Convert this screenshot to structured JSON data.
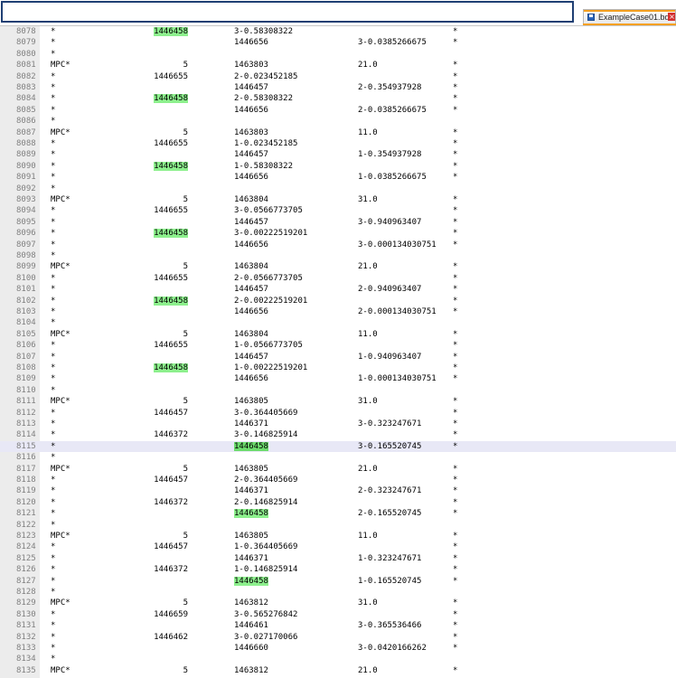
{
  "search": {
    "value": ""
  },
  "tab": {
    "label": "ExampleCase01.bdf",
    "icon": "save-icon",
    "close_icon": "close-icon"
  },
  "active_line": "8115",
  "highlight_token": "1446458",
  "colors": {
    "highlight": "#8df08d",
    "active_line": "#e8e8f6",
    "tab_accent": "#f4a020",
    "search_border": "#1f3f73"
  },
  "lines": [
    {
      "n": "8078",
      "c1": "*",
      "c2": "1446458",
      "c3": "3-0.58308322",
      "c4": "",
      "c5": "*"
    },
    {
      "n": "8079",
      "c1": "*",
      "c2": "",
      "c3": "1446656",
      "c4": "3-0.0385266675",
      "c5": "*"
    },
    {
      "n": "8080",
      "c1": "*",
      "c2": "",
      "c3": "",
      "c4": "",
      "c5": ""
    },
    {
      "n": "8081",
      "c1": "MPC*",
      "c2": "5",
      "c3": "1463803",
      "c4": "21.0",
      "c5": "*"
    },
    {
      "n": "8082",
      "c1": "*",
      "c2": "1446655",
      "c3": "2-0.023452185",
      "c4": "",
      "c5": "*"
    },
    {
      "n": "8083",
      "c1": "*",
      "c2": "",
      "c3": "1446457",
      "c4": "2-0.354937928",
      "c5": "*"
    },
    {
      "n": "8084",
      "c1": "*",
      "c2": "1446458",
      "c3": "2-0.58308322",
      "c4": "",
      "c5": "*"
    },
    {
      "n": "8085",
      "c1": "*",
      "c2": "",
      "c3": "1446656",
      "c4": "2-0.0385266675",
      "c5": "*"
    },
    {
      "n": "8086",
      "c1": "*",
      "c2": "",
      "c3": "",
      "c4": "",
      "c5": ""
    },
    {
      "n": "8087",
      "c1": "MPC*",
      "c2": "5",
      "c3": "1463803",
      "c4": "11.0",
      "c5": "*"
    },
    {
      "n": "8088",
      "c1": "*",
      "c2": "1446655",
      "c3": "1-0.023452185",
      "c4": "",
      "c5": "*"
    },
    {
      "n": "8089",
      "c1": "*",
      "c2": "",
      "c3": "1446457",
      "c4": "1-0.354937928",
      "c5": "*"
    },
    {
      "n": "8090",
      "c1": "*",
      "c2": "1446458",
      "c3": "1-0.58308322",
      "c4": "",
      "c5": "*"
    },
    {
      "n": "8091",
      "c1": "*",
      "c2": "",
      "c3": "1446656",
      "c4": "1-0.0385266675",
      "c5": "*"
    },
    {
      "n": "8092",
      "c1": "*",
      "c2": "",
      "c3": "",
      "c4": "",
      "c5": ""
    },
    {
      "n": "8093",
      "c1": "MPC*",
      "c2": "5",
      "c3": "1463804",
      "c4": "31.0",
      "c5": "*"
    },
    {
      "n": "8094",
      "c1": "*",
      "c2": "1446655",
      "c3": "3-0.0566773705",
      "c4": "",
      "c5": "*"
    },
    {
      "n": "8095",
      "c1": "*",
      "c2": "",
      "c3": "1446457",
      "c4": "3-0.940963407",
      "c5": "*"
    },
    {
      "n": "8096",
      "c1": "*",
      "c2": "1446458",
      "c3": "3-0.00222519201",
      "c4": "",
      "c5": "*"
    },
    {
      "n": "8097",
      "c1": "*",
      "c2": "",
      "c3": "1446656",
      "c4": "3-0.000134030751",
      "c5": "*"
    },
    {
      "n": "8098",
      "c1": "*",
      "c2": "",
      "c3": "",
      "c4": "",
      "c5": ""
    },
    {
      "n": "8099",
      "c1": "MPC*",
      "c2": "5",
      "c3": "1463804",
      "c4": "21.0",
      "c5": "*"
    },
    {
      "n": "8100",
      "c1": "*",
      "c2": "1446655",
      "c3": "2-0.0566773705",
      "c4": "",
      "c5": "*"
    },
    {
      "n": "8101",
      "c1": "*",
      "c2": "",
      "c3": "1446457",
      "c4": "2-0.940963407",
      "c5": "*"
    },
    {
      "n": "8102",
      "c1": "*",
      "c2": "1446458",
      "c3": "2-0.00222519201",
      "c4": "",
      "c5": "*"
    },
    {
      "n": "8103",
      "c1": "*",
      "c2": "",
      "c3": "1446656",
      "c4": "2-0.000134030751",
      "c5": "*"
    },
    {
      "n": "8104",
      "c1": "*",
      "c2": "",
      "c3": "",
      "c4": "",
      "c5": ""
    },
    {
      "n": "8105",
      "c1": "MPC*",
      "c2": "5",
      "c3": "1463804",
      "c4": "11.0",
      "c5": "*"
    },
    {
      "n": "8106",
      "c1": "*",
      "c2": "1446655",
      "c3": "1-0.0566773705",
      "c4": "",
      "c5": "*"
    },
    {
      "n": "8107",
      "c1": "*",
      "c2": "",
      "c3": "1446457",
      "c4": "1-0.940963407",
      "c5": "*"
    },
    {
      "n": "8108",
      "c1": "*",
      "c2": "1446458",
      "c3": "1-0.00222519201",
      "c4": "",
      "c5": "*"
    },
    {
      "n": "8109",
      "c1": "*",
      "c2": "",
      "c3": "1446656",
      "c4": "1-0.000134030751",
      "c5": "*"
    },
    {
      "n": "8110",
      "c1": "*",
      "c2": "",
      "c3": "",
      "c4": "",
      "c5": ""
    },
    {
      "n": "8111",
      "c1": "MPC*",
      "c2": "5",
      "c3": "1463805",
      "c4": "31.0",
      "c5": "*"
    },
    {
      "n": "8112",
      "c1": "*",
      "c2": "1446457",
      "c3": "3-0.364405669",
      "c4": "",
      "c5": "*"
    },
    {
      "n": "8113",
      "c1": "*",
      "c2": "",
      "c3": "1446371",
      "c4": "3-0.323247671",
      "c5": "*"
    },
    {
      "n": "8114",
      "c1": "*",
      "c2": "1446372",
      "c3": "3-0.146825914",
      "c4": "",
      "c5": "*"
    },
    {
      "n": "8115",
      "c1": "*",
      "c2": "",
      "c3": "1446458",
      "c4": "3-0.165520745",
      "c5": "*"
    },
    {
      "n": "8116",
      "c1": "*",
      "c2": "",
      "c3": "",
      "c4": "",
      "c5": ""
    },
    {
      "n": "8117",
      "c1": "MPC*",
      "c2": "5",
      "c3": "1463805",
      "c4": "21.0",
      "c5": "*"
    },
    {
      "n": "8118",
      "c1": "*",
      "c2": "1446457",
      "c3": "2-0.364405669",
      "c4": "",
      "c5": "*"
    },
    {
      "n": "8119",
      "c1": "*",
      "c2": "",
      "c3": "1446371",
      "c4": "2-0.323247671",
      "c5": "*"
    },
    {
      "n": "8120",
      "c1": "*",
      "c2": "1446372",
      "c3": "2-0.146825914",
      "c4": "",
      "c5": "*"
    },
    {
      "n": "8121",
      "c1": "*",
      "c2": "",
      "c3": "1446458",
      "c4": "2-0.165520745",
      "c5": "*"
    },
    {
      "n": "8122",
      "c1": "*",
      "c2": "",
      "c3": "",
      "c4": "",
      "c5": ""
    },
    {
      "n": "8123",
      "c1": "MPC*",
      "c2": "5",
      "c3": "1463805",
      "c4": "11.0",
      "c5": "*"
    },
    {
      "n": "8124",
      "c1": "*",
      "c2": "1446457",
      "c3": "1-0.364405669",
      "c4": "",
      "c5": "*"
    },
    {
      "n": "8125",
      "c1": "*",
      "c2": "",
      "c3": "1446371",
      "c4": "1-0.323247671",
      "c5": "*"
    },
    {
      "n": "8126",
      "c1": "*",
      "c2": "1446372",
      "c3": "1-0.146825914",
      "c4": "",
      "c5": "*"
    },
    {
      "n": "8127",
      "c1": "*",
      "c2": "",
      "c3": "1446458",
      "c4": "1-0.165520745",
      "c5": "*"
    },
    {
      "n": "8128",
      "c1": "*",
      "c2": "",
      "c3": "",
      "c4": "",
      "c5": ""
    },
    {
      "n": "8129",
      "c1": "MPC*",
      "c2": "5",
      "c3": "1463812",
      "c4": "31.0",
      "c5": "*"
    },
    {
      "n": "8130",
      "c1": "*",
      "c2": "1446659",
      "c3": "3-0.565276842",
      "c4": "",
      "c5": "*"
    },
    {
      "n": "8131",
      "c1": "*",
      "c2": "",
      "c3": "1446461",
      "c4": "3-0.365536466",
      "c5": "*"
    },
    {
      "n": "8132",
      "c1": "*",
      "c2": "1446462",
      "c3": "3-0.027170066",
      "c4": "",
      "c5": "*"
    },
    {
      "n": "8133",
      "c1": "*",
      "c2": "",
      "c3": "1446660",
      "c4": "3-0.0420166262",
      "c5": "*"
    },
    {
      "n": "8134",
      "c1": "*",
      "c2": "",
      "c3": "",
      "c4": "",
      "c5": ""
    },
    {
      "n": "8135",
      "c1": "MPC*",
      "c2": "5",
      "c3": "1463812",
      "c4": "21.0",
      "c5": "*"
    }
  ]
}
